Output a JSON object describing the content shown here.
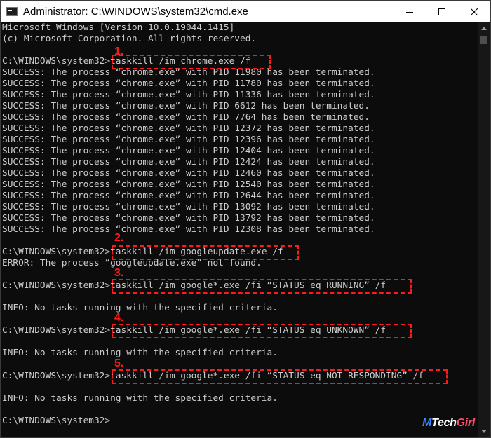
{
  "window": {
    "title": "Administrator: C:\\WINDOWS\\system32\\cmd.exe",
    "icon": "cmd-icon",
    "controls": [
      "minimize-icon",
      "maximize-icon",
      "close-icon"
    ]
  },
  "console": {
    "header": [
      "Microsoft Windows [Version 10.0.19044.1415]",
      "(c) Microsoft Corporation. All rights reserved."
    ],
    "prompt": "C:\\WINDOWS\\system32>",
    "commands": [
      {
        "step": "1.",
        "text": "taskkill /im chrome.exe /f",
        "output": [
          "SUCCESS: The process “chrome.exe” with PID 11980 has been terminated.",
          "SUCCESS: The process “chrome.exe” with PID 11780 has been terminated.",
          "SUCCESS: The process “chrome.exe” with PID 11336 has been terminated.",
          "SUCCESS: The process “chrome.exe” with PID 6612 has been terminated.",
          "SUCCESS: The process “chrome.exe” with PID 7764 has been terminated.",
          "SUCCESS: The process “chrome.exe” with PID 12372 has been terminated.",
          "SUCCESS: The process “chrome.exe” with PID 12396 has been terminated.",
          "SUCCESS: The process “chrome.exe” with PID 12404 has been terminated.",
          "SUCCESS: The process “chrome.exe” with PID 12424 has been terminated.",
          "SUCCESS: The process “chrome.exe” with PID 12460 has been terminated.",
          "SUCCESS: The process “chrome.exe” with PID 12540 has been terminated.",
          "SUCCESS: The process “chrome.exe” with PID 12644 has been terminated.",
          "SUCCESS: The process “chrome.exe” with PID 13092 has been terminated.",
          "SUCCESS: The process “chrome.exe” with PID 13792 has been terminated.",
          "SUCCESS: The process “chrome.exe” with PID 12308 has been terminated."
        ]
      },
      {
        "step": "2.",
        "text": "taskkill /im googleupdate.exe /f",
        "output": [
          "ERROR: The process “googleupdate.exe” not found."
        ]
      },
      {
        "step": "3.",
        "text": "taskkill /im google*.exe /fi “STATUS eq RUNNING” /f",
        "output": [
          "INFO: No tasks running with the specified criteria."
        ]
      },
      {
        "step": "4.",
        "text": "taskkill /im google*.exe /fi “STATUS eq UNKNOWN” /f",
        "output": [
          "INFO: No tasks running with the specified criteria."
        ]
      },
      {
        "step": "5.",
        "text": "taskkill /im google*.exe /fi “STATUS eq NOT RESPONDING” /f",
        "output": [
          "INFO: No tasks running with the specified criteria."
        ]
      }
    ]
  },
  "watermark": {
    "part1": "M",
    "part2": "Tech",
    "part3": "Girl"
  },
  "colors": {
    "background": "#0c0c0c",
    "text": "#cccccc",
    "highlight": "#ff1a1a"
  }
}
